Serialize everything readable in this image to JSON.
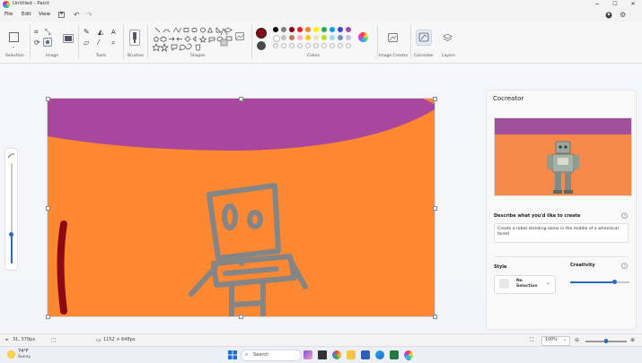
{
  "window": {
    "title": "Untitled - Paint",
    "minimize": "─",
    "maximize": "☐",
    "close": "✕"
  },
  "menu": {
    "file": "File",
    "edit": "Edit",
    "view": "View"
  },
  "ribbon": {
    "groups": {
      "selection": "Selection",
      "image": "Image",
      "tools": "Tools",
      "brushes": "Brushes",
      "shapes": "Shapes",
      "colors": "Colors",
      "image_creator": "Image Creator",
      "cocreator": "Cocreator",
      "layers": "Layers"
    },
    "primary_color": "#8b0a14",
    "secondary_color": "#4a4a4a",
    "palette_row1": [
      "#000000",
      "#7f7f7f",
      "#880015",
      "#ed1c24",
      "#ff7f27",
      "#fff200",
      "#22b14c",
      "#00a2e8",
      "#3f48cc",
      "#a349a4"
    ],
    "palette_row2": [
      "#ffffff",
      "#c3c3c3",
      "#b97a57",
      "#ffaec9",
      "#ffc90e",
      "#efe4b0",
      "#b5e61d",
      "#99d9ea",
      "#7092be",
      "#c8bfe7"
    ]
  },
  "cocreator": {
    "title": "Cocreator",
    "describe_label": "Describe what you'd like to create",
    "prompt": "Create a robot standing alone in the middle of a whimsical forest",
    "style_label": "Style",
    "style_value": "No Selection",
    "creativity_label": "Creativity",
    "creativity_value": 0.75
  },
  "status": {
    "position": "31, 379px",
    "size": "1152 × 648px",
    "zoom": "100%",
    "zoom_fraction": 0.5
  },
  "taskbar": {
    "search_placeholder": "Search",
    "weather_temp": "74°F",
    "weather_text": "Sunny"
  }
}
